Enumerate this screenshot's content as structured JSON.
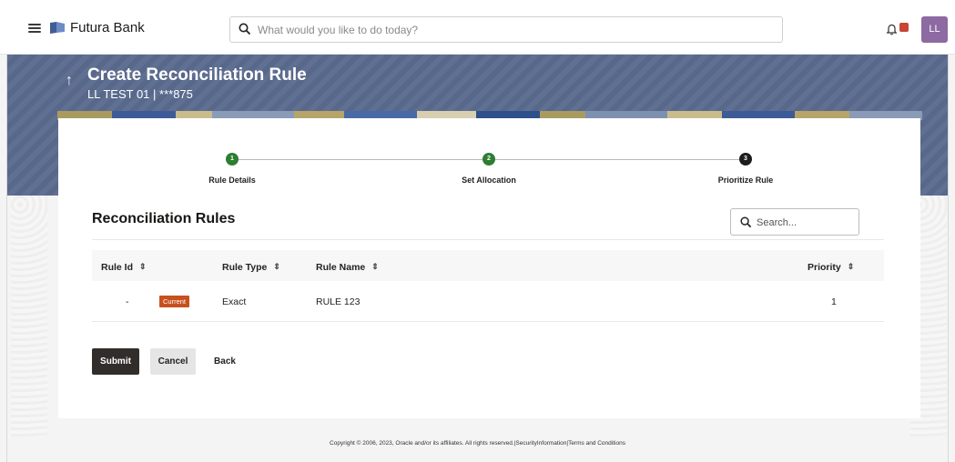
{
  "header": {
    "brand": "Futura Bank",
    "search_placeholder": "What would you like to do today?",
    "notification_count": "",
    "avatar_initials": "LL"
  },
  "banner": {
    "title": "Create Reconciliation Rule",
    "subtitle": "LL TEST 01 | ***875"
  },
  "stepper": {
    "steps": [
      {
        "number": "1",
        "label": "Rule Details",
        "state": "done"
      },
      {
        "number": "2",
        "label": "Set Allocation",
        "state": "done"
      },
      {
        "number": "3",
        "label": "Prioritize Rule",
        "state": "current"
      }
    ]
  },
  "section": {
    "title": "Reconciliation Rules",
    "search_placeholder": "Search..."
  },
  "table": {
    "columns": [
      "Rule Id",
      "Rule Type",
      "Rule Name",
      "Priority"
    ],
    "rows": [
      {
        "rule_id": "-",
        "badge": "Current",
        "rule_type": "Exact",
        "rule_name": "RULE 123",
        "priority": "1"
      }
    ]
  },
  "actions": {
    "submit": "Submit",
    "cancel": "Cancel",
    "back": "Back"
  },
  "footer": {
    "text": "Copyright © 2006, 2023, Oracle and/or its affiliates. All rights reserved.|SecurityInformation|Terms and Conditions"
  },
  "colors": {
    "banner": "#5b6b8f",
    "step_done": "#2e7d32",
    "badge": "#c8501f",
    "submit": "#312d2a"
  }
}
